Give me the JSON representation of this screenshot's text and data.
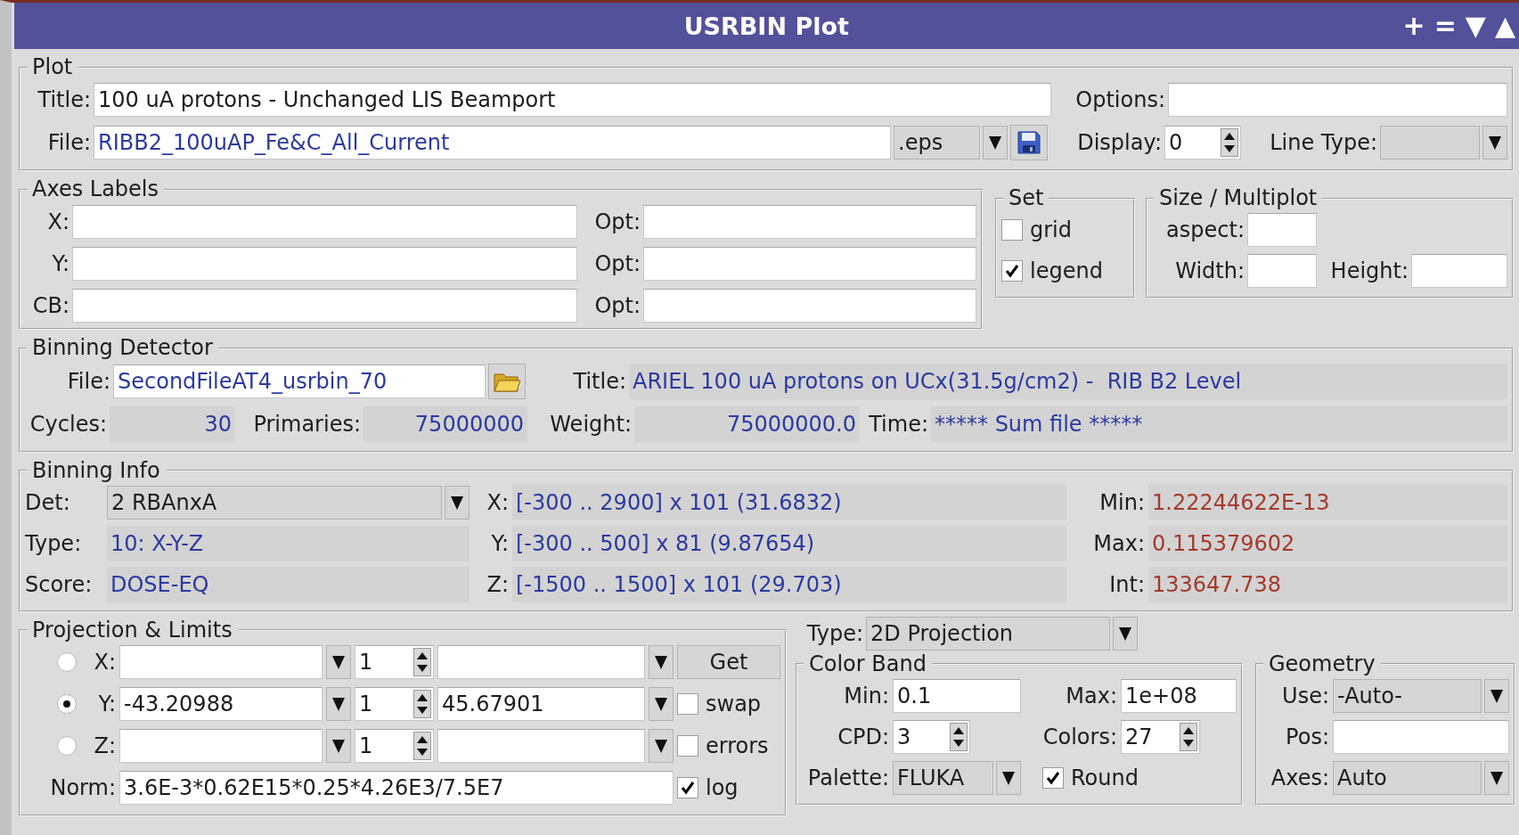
{
  "window": {
    "title": "USRBIN Plot",
    "buttons": [
      "+",
      "=",
      "▼",
      "▲"
    ]
  },
  "plot": {
    "heading": "Plot",
    "title": {
      "label": "Title:",
      "value": "100 uA protons - Unchanged LIS Beamport"
    },
    "options": {
      "label": "Options:"
    },
    "file": {
      "label": "File:",
      "value": "RIBB2_100uAP_Fe&C_All_Current",
      "extension": ".eps"
    },
    "display": {
      "label": "Display:",
      "value": "0"
    },
    "line_type": {
      "label": "Line Type:"
    }
  },
  "axes_labels": {
    "heading": "Axes Labels",
    "rows": [
      {
        "label": "X:",
        "opt_label": "Opt:"
      },
      {
        "label": "Y:",
        "opt_label": "Opt:"
      },
      {
        "label": "CB:",
        "opt_label": "Opt:"
      }
    ]
  },
  "set": {
    "heading": "Set",
    "options": [
      {
        "label": "grid",
        "checked": false
      },
      {
        "label": "legend",
        "checked": true
      }
    ]
  },
  "size_multiplot": {
    "heading": "Size / Multiplot",
    "aspect": {
      "label": "aspect:"
    },
    "width": {
      "label": "Width:"
    },
    "height": {
      "label": "Height:"
    }
  },
  "binning_detector": {
    "heading": "Binning Detector",
    "file": {
      "label": "File:",
      "value": "SecondFileAT4_usrbin_70"
    },
    "title": {
      "label": "Title:",
      "value": "ARIEL 100 uA protons on UCx(31.5g/cm2) -  RIB B2 Level"
    },
    "cycles": {
      "label": "Cycles:",
      "value": "30"
    },
    "primaries": {
      "label": "Primaries:",
      "value": "75000000"
    },
    "weight": {
      "label": "Weight:",
      "value": "75000000.0"
    },
    "time": {
      "label": "Time:",
      "value": "***** Sum file *****"
    }
  },
  "binning_info": {
    "heading": "Binning Info",
    "det": {
      "label": "Det:",
      "value": "2 RBAnxA"
    },
    "type": {
      "label": "Type:",
      "value": "10: X-Y-Z"
    },
    "score": {
      "label": "Score:",
      "value": "DOSE-EQ"
    },
    "x": {
      "label": "X:",
      "value": "[-300 .. 2900] x 101 (31.6832)"
    },
    "y": {
      "label": "Y:",
      "value": "[-300 .. 500] x 81 (9.87654)"
    },
    "z": {
      "label": "Z:",
      "value": "[-1500 .. 1500] x 101 (29.703)"
    },
    "min": {
      "label": "Min:",
      "value": "1.22244622E-13"
    },
    "max": {
      "label": "Max:",
      "value": "0.115379602"
    },
    "int": {
      "label": "Int:",
      "value": "133647.738"
    }
  },
  "projection": {
    "heading": "Projection & Limits",
    "axes": [
      {
        "label": "X:",
        "selected": false,
        "spin": "1"
      },
      {
        "label": "Y:",
        "selected": true,
        "from": "-43.20988",
        "spin": "1",
        "to": "45.67901"
      },
      {
        "label": "Z:",
        "selected": false,
        "spin": "1"
      }
    ],
    "get_button": "Get",
    "options": [
      {
        "label": "swap",
        "checked": false
      },
      {
        "label": "errors",
        "checked": false
      }
    ],
    "norm": {
      "label": "Norm:",
      "value": "3.6E-3*0.62E15*0.25*4.26E3/7.5E7"
    },
    "log": {
      "label": "log",
      "checked": true
    }
  },
  "type": {
    "label": "Type:",
    "value": "2D Projection"
  },
  "color_band": {
    "heading": "Color Band",
    "min": {
      "label": "Min:",
      "value": "0.1"
    },
    "max": {
      "label": "Max:",
      "value": "1e+08"
    },
    "cpd": {
      "label": "CPD:",
      "value": "3"
    },
    "colors": {
      "label": "Colors:",
      "value": "27"
    },
    "palette": {
      "label": "Palette:",
      "value": "FLUKA"
    },
    "round": {
      "label": "Round",
      "checked": true
    }
  },
  "geometry": {
    "heading": "Geometry",
    "use": {
      "label": "Use:",
      "value": "-Auto-"
    },
    "pos": {
      "label": "Pos:"
    },
    "axes": {
      "label": "Axes:",
      "value": "Auto"
    }
  }
}
